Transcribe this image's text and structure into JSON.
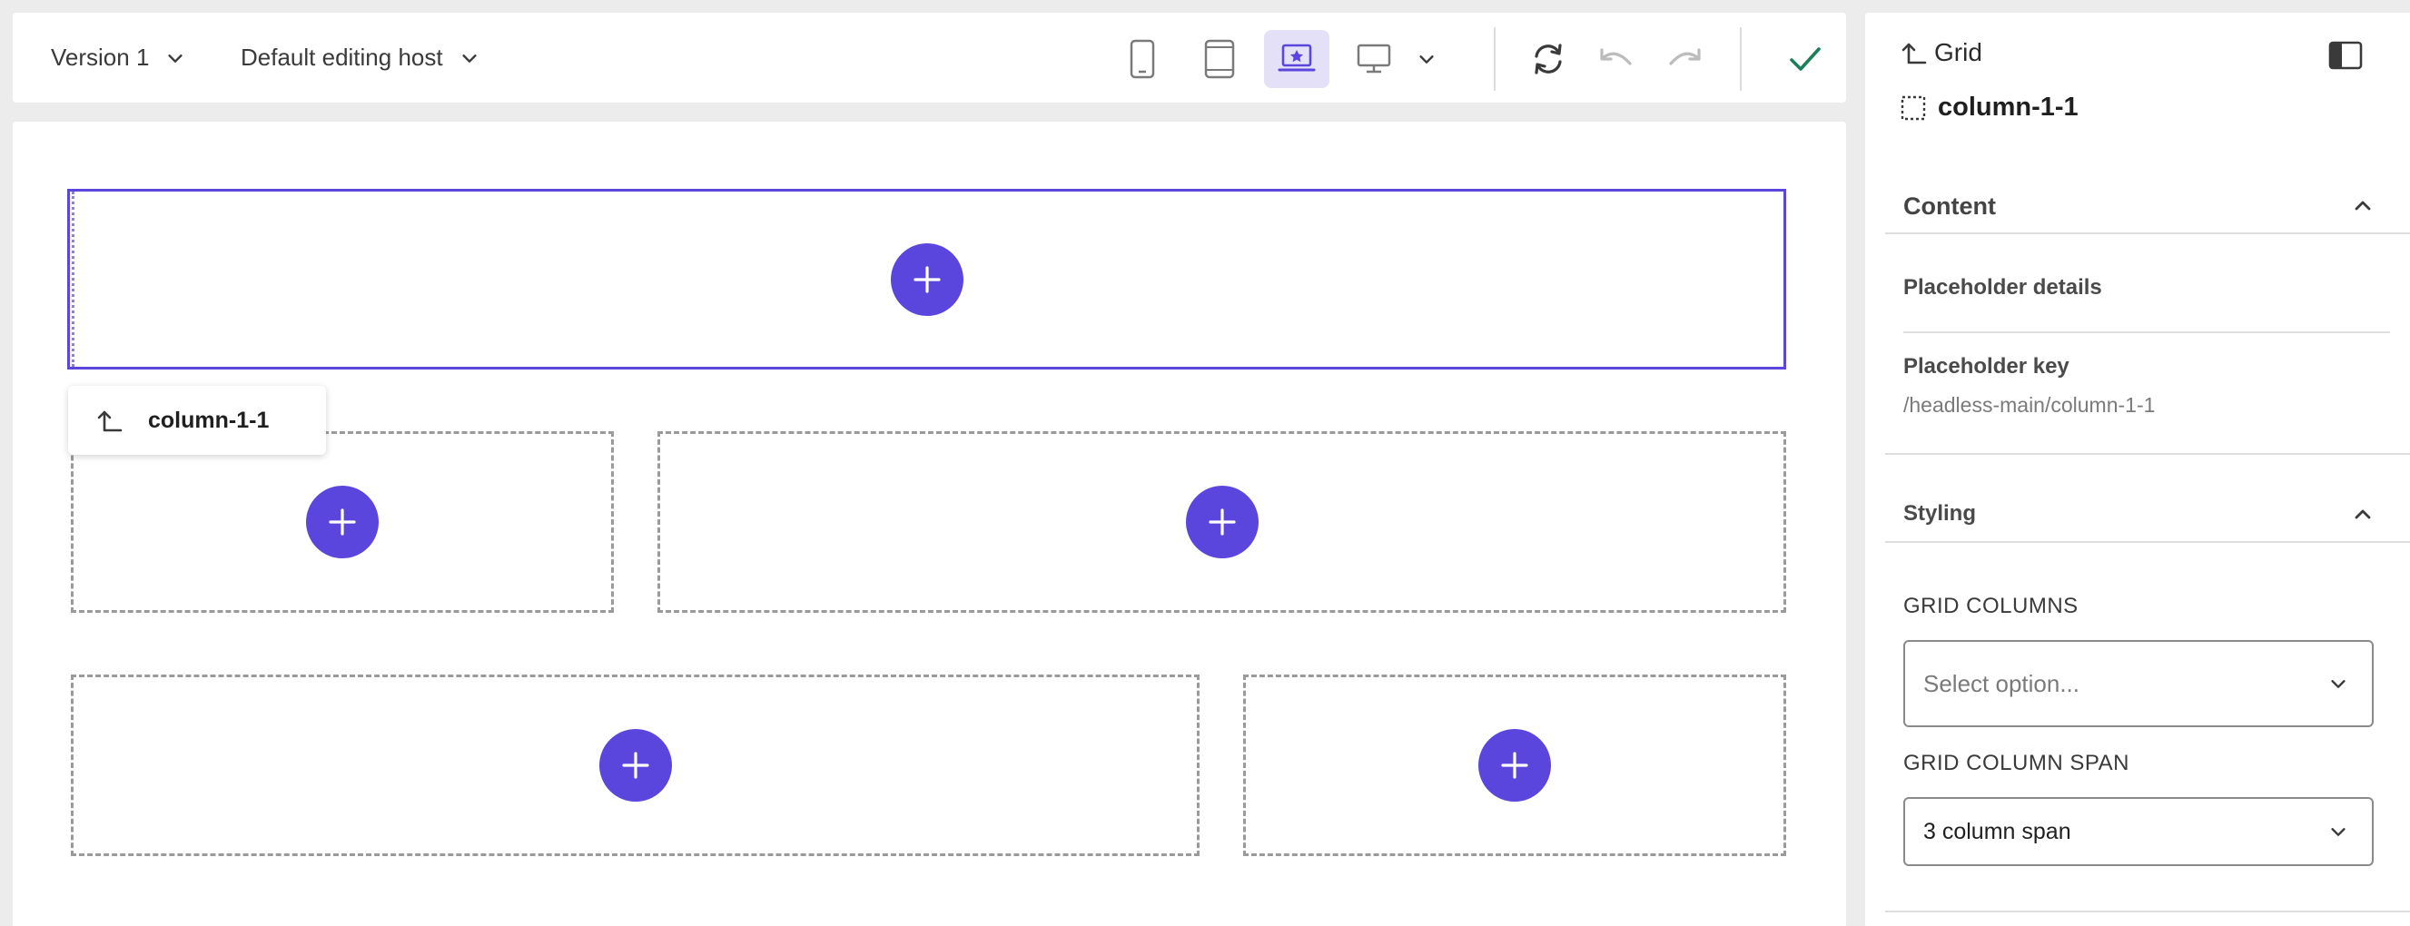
{
  "toolbar": {
    "version_label": "Version 1",
    "host_label": "Default editing host",
    "devices": [
      "mobile-icon",
      "tablet-icon",
      "laptop-icon",
      "desktop-icon"
    ],
    "active_device": "laptop-icon",
    "actions": [
      "refresh-icon",
      "undo-icon",
      "redo-icon",
      "check-icon"
    ]
  },
  "canvas": {
    "selected_chip_label": "column-1-1",
    "placeholders": [
      "column-1-1",
      "row-2-left",
      "row-2-right",
      "row-3-left",
      "row-3-right"
    ]
  },
  "panel": {
    "parent_label": "Grid",
    "component_label": "column-1-1",
    "content_section": "Content",
    "placeholder_details": "Placeholder details",
    "placeholder_key_label": "Placeholder key",
    "placeholder_key_value": "/headless-main/column-1-1",
    "styling_section": "Styling",
    "grid_columns_label": "GRID COLUMNS",
    "grid_columns_placeholder": "Select option...",
    "grid_column_span_label": "GRID COLUMN SPAN",
    "grid_column_span_value": "3 column span"
  },
  "colors": {
    "accent": "#5a46dc",
    "accent_light": "#e3e0f7",
    "success": "#1b7f5a"
  }
}
